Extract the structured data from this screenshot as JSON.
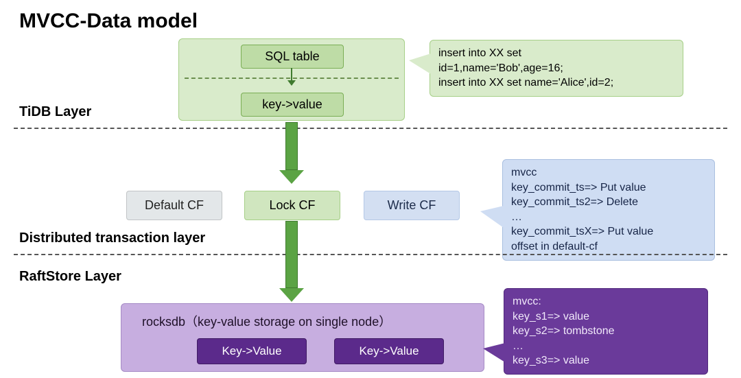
{
  "title": "MVCC-Data model",
  "layers": {
    "tidb": "TiDB Layer",
    "dist": "Distributed transaction layer",
    "raft": "RaftStore Layer"
  },
  "tidb_panel": {
    "sql_table": "SQL table",
    "key_value": "key->value"
  },
  "callout_sql": "insert into XX set\nid=1,name='Bob',age=16;\ninsert into XX set name='Alice',id=2;",
  "cf": {
    "default": "Default CF",
    "lock": "Lock CF",
    "write": "Write CF"
  },
  "callout_write": "mvcc\nkey_commit_ts=> Put value\nkey_commit_ts2=> Delete\n…\nkey_commit_tsX=> Put value\noffset in default-cf",
  "rocks": {
    "desc": "rocksdb（key-value storage on single node）",
    "kv1": "Key->Value",
    "kv2": "Key->Value"
  },
  "callout_rocks": "mvcc:\nkey_s1=> value\nkey_s2=> tombstone\n…\nkey_s3=> value"
}
